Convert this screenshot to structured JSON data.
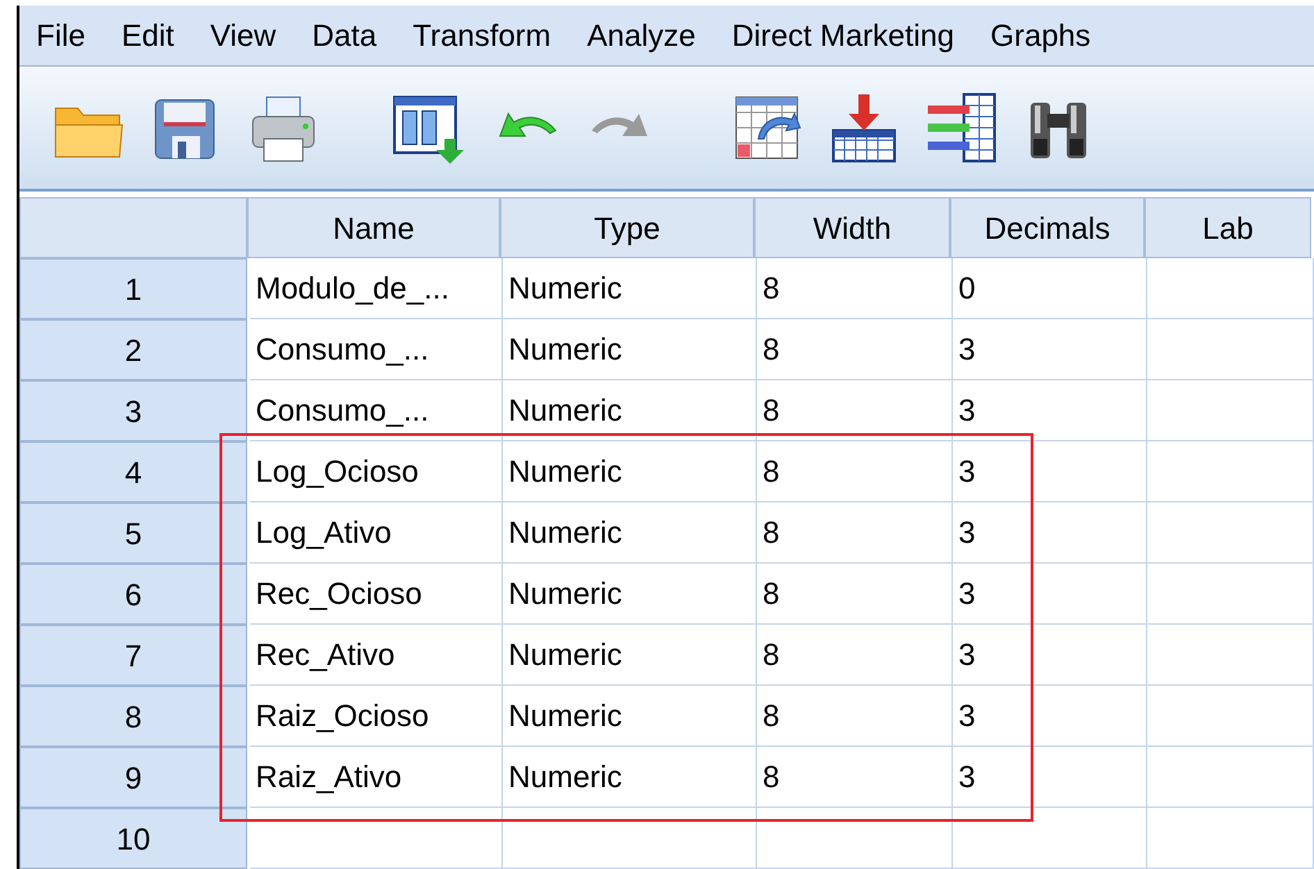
{
  "menu": [
    {
      "label": "File"
    },
    {
      "label": "Edit"
    },
    {
      "label": "View"
    },
    {
      "label": "Data"
    },
    {
      "label": "Transform"
    },
    {
      "label": "Analyze"
    },
    {
      "label": "Direct Marketing"
    },
    {
      "label": "Graphs"
    }
  ],
  "toolbar": [
    {
      "kind": "open"
    },
    {
      "kind": "save"
    },
    {
      "kind": "print"
    },
    {
      "kind": "dialog"
    },
    {
      "kind": "undo"
    },
    {
      "kind": "redo",
      "disabled": true
    },
    {
      "kind": "goto"
    },
    {
      "kind": "insert"
    },
    {
      "kind": "variables"
    },
    {
      "kind": "find"
    }
  ],
  "table": {
    "columns": [
      "Name",
      "Type",
      "Width",
      "Decimals",
      "Lab"
    ],
    "rows": [
      {
        "number": "1",
        "cells": [
          "Modulo_de_...",
          "Numeric",
          "8",
          "0"
        ],
        "highlighted": false
      },
      {
        "number": "2",
        "cells": [
          "Consumo_...",
          "Numeric",
          "8",
          "3"
        ],
        "highlighted": false
      },
      {
        "number": "3",
        "cells": [
          "Consumo_...",
          "Numeric",
          "8",
          "3"
        ],
        "highlighted": false
      },
      {
        "number": "4",
        "cells": [
          "Log_Ocioso",
          "Numeric",
          "8",
          "3"
        ],
        "highlighted": true
      },
      {
        "number": "5",
        "cells": [
          "Log_Ativo",
          "Numeric",
          "8",
          "3"
        ],
        "highlighted": true
      },
      {
        "number": "6",
        "cells": [
          "Rec_Ocioso",
          "Numeric",
          "8",
          "3"
        ],
        "highlighted": true
      },
      {
        "number": "7",
        "cells": [
          "Rec_Ativo",
          "Numeric",
          "8",
          "3"
        ],
        "highlighted": true
      },
      {
        "number": "8",
        "cells": [
          "Raiz_Ocioso",
          "Numeric",
          "8",
          "3"
        ],
        "highlighted": true
      },
      {
        "number": "9",
        "cells": [
          "Raiz_Ativo",
          "Numeric",
          "8",
          "3"
        ],
        "highlighted": true
      },
      {
        "number": "10",
        "cells": [],
        "highlighted": false
      }
    ]
  }
}
